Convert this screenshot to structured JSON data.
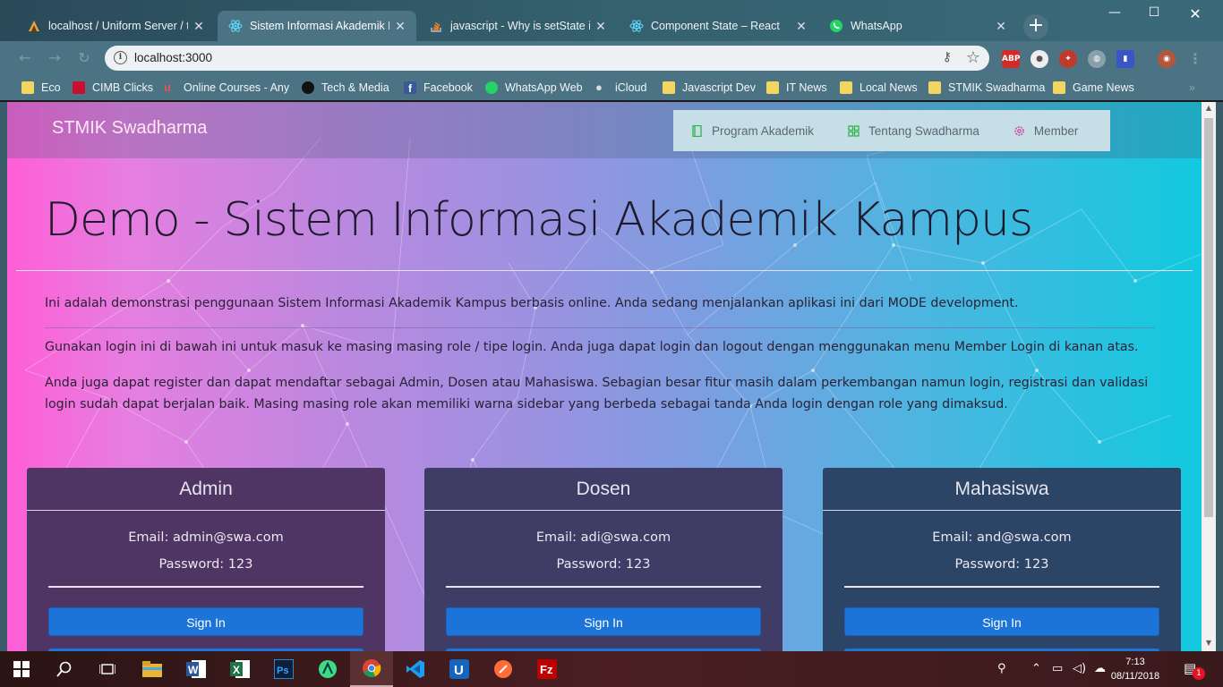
{
  "browser": {
    "tabs": [
      {
        "title": "localhost / Uniform Server / tu",
        "icon": "uniform-server-icon"
      },
      {
        "title": "Sistem Informasi Akademik Ka",
        "icon": "react-icon",
        "active": true
      },
      {
        "title": "javascript - Why is setState in",
        "icon": "stackoverflow-icon"
      },
      {
        "title": "Component State – React",
        "icon": "react-icon"
      },
      {
        "title": "WhatsApp",
        "icon": "whatsapp-icon"
      }
    ],
    "url": "localhost:3000",
    "extensions": [
      "ABP"
    ],
    "bookmarks": [
      {
        "label": "Eco",
        "icon": "folder-icon"
      },
      {
        "label": "CIMB Clicks",
        "icon": "cimb-icon"
      },
      {
        "label": "Online Courses - Any",
        "icon": "udemy-icon"
      },
      {
        "label": "Tech & Media",
        "icon": "github-icon"
      },
      {
        "label": "Facebook",
        "icon": "facebook-icon"
      },
      {
        "label": "WhatsApp Web",
        "icon": "whatsapp-icon"
      },
      {
        "label": "iCloud",
        "icon": "apple-icon"
      },
      {
        "label": "Javascript Dev",
        "icon": "folder-icon"
      },
      {
        "label": "IT News",
        "icon": "folder-icon"
      },
      {
        "label": "Local News",
        "icon": "folder-icon"
      },
      {
        "label": "STMIK Swadharma",
        "icon": "folder-icon"
      },
      {
        "label": "Game News",
        "icon": "folder-icon"
      }
    ]
  },
  "site": {
    "brand": "STMIK Swadharma",
    "menu": [
      {
        "label": "Program Akademik",
        "icon": "book-icon"
      },
      {
        "label": "Tentang Swadharma",
        "icon": "grid-icon"
      },
      {
        "label": "Member",
        "icon": "gear-icon"
      }
    ],
    "title": "Demo - Sistem Informasi Akademik Kampus",
    "intro": "Ini adalah demonstrasi penggunaan Sistem Informasi Akademik Kampus berbasis online. Anda sedang menjalankan aplikasi ini dari MODE development.",
    "login_info": "Gunakan login ini di bawah ini untuk masuk ke masing masing role / tipe login. Anda juga dapat login dan logout dengan menggunakan menu Member Login di kanan atas.",
    "register_info": "Anda juga dapat register dan dapat mendaftar sebagai Admin, Dosen atau Mahasiswa. Sebagian besar fitur masih dalam perkembangan namun login, registrasi dan validasi login sudah dapat berjalan baik. Masing masing role akan memiliki warna sidebar yang berbeda sebagai tanda Anda login dengan role yang dimaksud.",
    "cards": [
      {
        "title": "Admin",
        "email": "Email: admin@swa.com",
        "password": "Password: 123",
        "button": "Sign In",
        "color": "#4f3563"
      },
      {
        "title": "Dosen",
        "email": "Email: adi@swa.com",
        "password": "Password: 123",
        "button": "Sign In",
        "color": "#3f3c66"
      },
      {
        "title": "Mahasiswa",
        "email": "Email: and@swa.com",
        "password": "Password: 123",
        "button": "Sign In",
        "color": "#2c4566"
      }
    ]
  },
  "taskbar": {
    "apps": [
      "windows-start-icon",
      "search-icon",
      "task-view-icon",
      "file-explorer-icon",
      "word-icon",
      "excel-icon",
      "photoshop-icon",
      "android-studio-icon",
      "chrome-icon",
      "vscode-icon",
      "ultraedit-icon",
      "postman-icon",
      "filezilla-icon"
    ],
    "time": "7:13",
    "date": "08/11/2018",
    "notification_count": "1"
  }
}
